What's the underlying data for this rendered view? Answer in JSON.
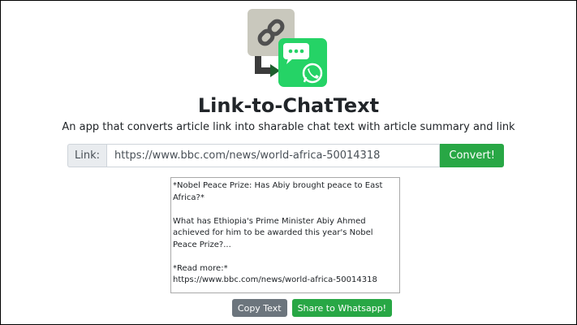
{
  "app": {
    "title": "Link-to-ChatText",
    "subtitle": "An app that converts article link into sharable chat text with article summary and link"
  },
  "form": {
    "label": "Link:",
    "url_value": "https://www.bbc.com/news/world-africa-50014318",
    "convert_label": "Convert!"
  },
  "output": {
    "text": "*Nobel Peace Prize: Has Abiy brought peace to East Africa?*\n\nWhat has Ethiopia's Prime Minister Abiy Ahmed achieved for him to be awarded this year's Nobel Peace Prize?...\n\n*Read more:*\nhttps://www.bbc.com/news/world-africa-50014318"
  },
  "actions": {
    "copy_label": "Copy Text",
    "share_label": "Share to Whatsapp!"
  },
  "icons": {
    "logo": "link-to-whatsapp-logo-icon"
  },
  "colors": {
    "success": "#28a745",
    "secondary": "#6c757d",
    "whatsapp_green": "#25d366"
  }
}
